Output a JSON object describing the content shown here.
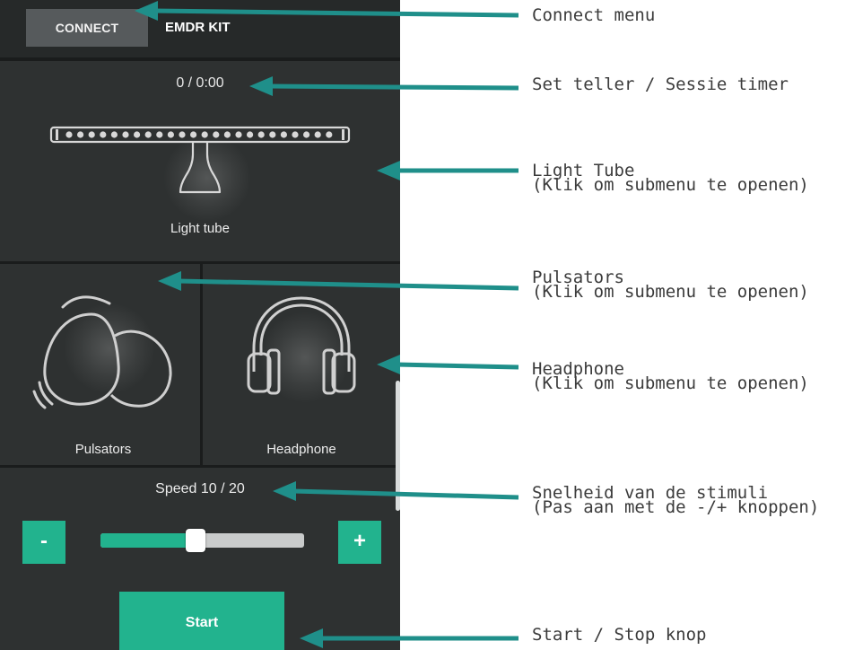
{
  "app": {
    "connect_label": "CONNECT",
    "title": "EMDR KIT",
    "counter": "0 / 0:00",
    "light_tube_label": "Light tube",
    "pulsators_label": "Pulsators",
    "headphone_label": "Headphone",
    "speed_label": "Speed 10 / 20",
    "speed": {
      "value": 10,
      "max": 20
    },
    "minus_label": "-",
    "plus_label": "+",
    "start_label": "Start"
  },
  "annotations": {
    "connect": {
      "line1": "Connect menu"
    },
    "counter": {
      "line1": "Set teller / Sessie timer"
    },
    "light_tube": {
      "line1": "Light Tube",
      "line2": "(Klik om submenu te openen)"
    },
    "pulsators": {
      "line1": "Pulsators",
      "line2": "(Klik om submenu te openen)"
    },
    "headphone": {
      "line1": "Headphone",
      "line2": "(Klik om submenu te openen)"
    },
    "speed": {
      "line1": "Snelheid van de stimuli",
      "line2": "(Pas aan met de -/+ knoppen)"
    },
    "start": {
      "line1": "Start / Stop knop"
    }
  },
  "colors": {
    "accent": "#22b38e",
    "arrow": "#1f8f8a",
    "background": "#2e3131"
  },
  "icons": [
    "light-tube-icon",
    "pulsator-eggs-icon",
    "headphone-icon"
  ]
}
